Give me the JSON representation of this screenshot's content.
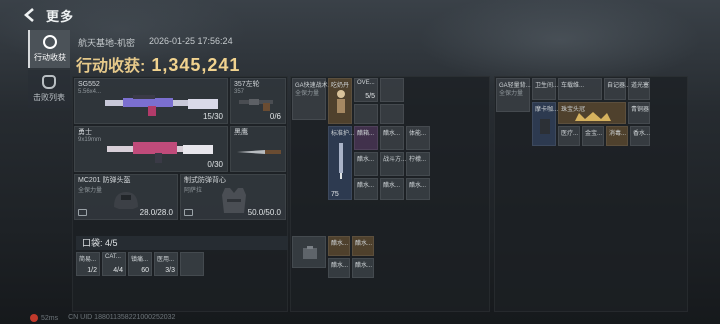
{
  "header": {
    "title": "更多"
  },
  "sidebar": {
    "tabs": [
      {
        "label": "行动收获",
        "active": true,
        "icon": "target-icon"
      },
      {
        "label": "击败列表",
        "active": false,
        "icon": "skull-icon"
      }
    ]
  },
  "meta": {
    "map": "航天基地-机密",
    "datetime": "2026-01-25 17:56:24"
  },
  "harvest": {
    "label": "行动收获:",
    "value": "1,345,241"
  },
  "weapons": [
    {
      "name": "SG552",
      "sub": "5.56x4...",
      "count": "15/30"
    },
    {
      "name": "357左轮",
      "sub": "357",
      "count": "0/6"
    },
    {
      "name": "勇士",
      "sub": "9x19mm",
      "count": "0/30"
    },
    {
      "name": "黑鹰",
      "sub": "",
      "count": ""
    }
  ],
  "armor": [
    {
      "name": "MC201 防弹头盔",
      "sub": "全保力量",
      "count": "28.0/28.0"
    },
    {
      "name": "制式防弹背心",
      "sub": "阿萨拉",
      "count": "50.0/50.0"
    }
  ],
  "pockets": {
    "label": "口袋: 4/5",
    "items": [
      {
        "name": "简易...",
        "count": "1/2"
      },
      {
        "name": "CAT...",
        "count": "4/4"
      },
      {
        "name": "镇痛...",
        "count": "60"
      },
      {
        "name": "医用...",
        "count": "3/3"
      }
    ]
  },
  "rig": {
    "label": "GA快速战术...",
    "sub": "全保力量",
    "cells": [
      {
        "label": "吃奶丹",
        "count": ""
      },
      {
        "label": "OVE...",
        "count": "5/5"
      },
      {
        "label": "标准护...",
        "count": ""
      },
      {
        "label": "醋箱..."
      },
      {
        "label": "醋水..."
      },
      {
        "label": "体能..."
      },
      {
        "label": "醋水..."
      },
      {
        "label": "战斗方..."
      },
      {
        "label": "柠檬..."
      },
      {
        "label": "醋水..."
      },
      {
        "label": "醋水..."
      },
      {
        "label": "醋水..."
      }
    ],
    "ammo_count": "75"
  },
  "backpack": {
    "label": "GA轻量背...",
    "sub": "全保力量",
    "cells": [
      {
        "label": "卫生间..."
      },
      {
        "label": "车载维..."
      },
      {
        "label": "自记器..."
      },
      {
        "label": "道光塞"
      },
      {
        "label": "摩卡咖..."
      },
      {
        "label": "珠宝头冠"
      },
      {
        "label": "青铜器"
      },
      {
        "label": "医疗..."
      },
      {
        "label": "金宝..."
      },
      {
        "label": "消毒..."
      },
      {
        "label": "香水..."
      },
      {
        "label": "香水..."
      }
    ]
  },
  "container": {
    "cells": [
      {
        "label": "醋水..."
      },
      {
        "label": "醋水..."
      },
      {
        "label": "醋水..."
      },
      {
        "label": "醋水..."
      }
    ]
  },
  "footer": {
    "ping": "52ms",
    "uid": "CN UID 188011358221000252032"
  }
}
